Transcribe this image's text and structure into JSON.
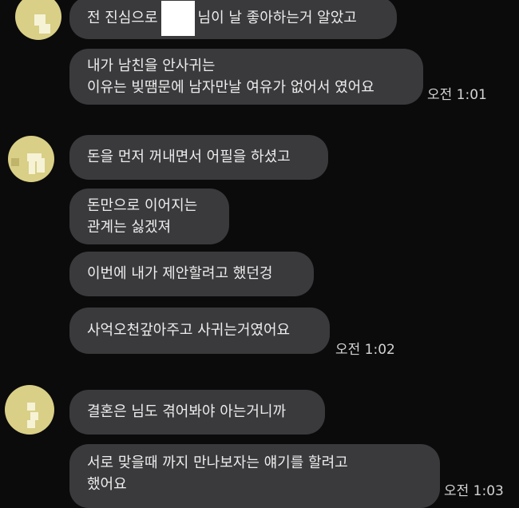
{
  "groups": [
    {
      "messages": [
        {
          "text_before": "전 진심으로",
          "text_after": "님이 날 좋아하는거 알았고"
        },
        {
          "lines": [
            "내가 남친을 안사귀는",
            "이유는 빚땜문에 남자만날 여유가 없어서 였어요"
          ]
        }
      ],
      "time": "오전 1:01"
    },
    {
      "messages": [
        {
          "lines": [
            "돈을 먼저 꺼내면서 어필을 하셨고"
          ]
        },
        {
          "lines": [
            "돈만으로 이어지는",
            "관계는 싫겠져"
          ]
        },
        {
          "lines": [
            "이번에 내가 제안할려고 했던겅"
          ]
        },
        {
          "lines": [
            "사억오천갚아주고 사귀는거였어요"
          ]
        }
      ],
      "time": "오전 1:02"
    },
    {
      "messages": [
        {
          "lines": [
            "결혼은 님도 겪어봐야 아는거니까"
          ]
        },
        {
          "lines": [
            "서로 맞을때 까지 만나보자는 얘기를 할려고",
            "했어요"
          ]
        }
      ],
      "time": "오전 1:03"
    }
  ]
}
